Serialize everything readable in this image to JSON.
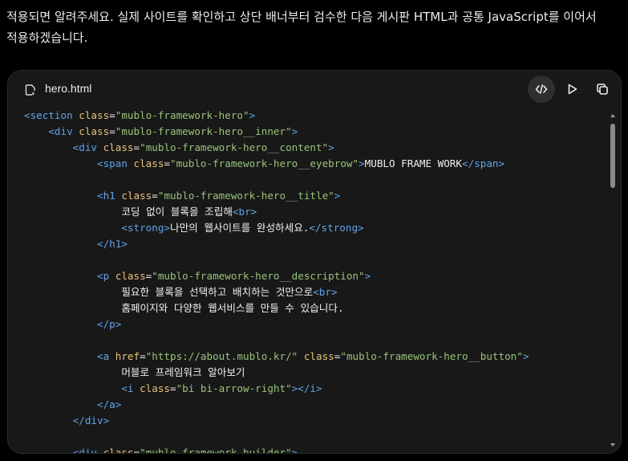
{
  "message": {
    "text": "적용되면 알려주세요. 실제 사이트를 확인하고 상단 배너부터 검수한 다음 게시판 HTML과 공통 JavaScript를 이어서 적용하겠습니다."
  },
  "code_card": {
    "filename": "hero.html",
    "file_icon": "file-code-icon",
    "buttons": {
      "code_toggle_icon": "code-brackets-icon",
      "run_icon": "play-icon",
      "copy_icon": "copy-icon"
    },
    "lines": [
      [
        {
          "t": "tag",
          "v": "<section "
        },
        {
          "t": "attr",
          "v": "class"
        },
        {
          "t": "txt",
          "v": "="
        },
        {
          "t": "val",
          "v": "\"mublo-framework-hero\""
        },
        {
          "t": "tag",
          "v": ">"
        }
      ],
      [
        {
          "t": "txt",
          "v": "    "
        },
        {
          "t": "tag",
          "v": "<div "
        },
        {
          "t": "attr",
          "v": "class"
        },
        {
          "t": "txt",
          "v": "="
        },
        {
          "t": "val",
          "v": "\"mublo-framework-hero__inner\""
        },
        {
          "t": "tag",
          "v": ">"
        }
      ],
      [
        {
          "t": "txt",
          "v": "        "
        },
        {
          "t": "tag",
          "v": "<div "
        },
        {
          "t": "attr",
          "v": "class"
        },
        {
          "t": "txt",
          "v": "="
        },
        {
          "t": "val",
          "v": "\"mublo-framework-hero__content\""
        },
        {
          "t": "tag",
          "v": ">"
        }
      ],
      [
        {
          "t": "txt",
          "v": "            "
        },
        {
          "t": "tag",
          "v": "<span "
        },
        {
          "t": "attr",
          "v": "class"
        },
        {
          "t": "txt",
          "v": "="
        },
        {
          "t": "val",
          "v": "\"mublo-framework-hero__eyebrow\""
        },
        {
          "t": "tag",
          "v": ">"
        },
        {
          "t": "txt",
          "v": "MUBLO FRAME WORK"
        },
        {
          "t": "tag",
          "v": "</span>"
        }
      ],
      [
        {
          "t": "txt",
          "v": ""
        }
      ],
      [
        {
          "t": "txt",
          "v": "            "
        },
        {
          "t": "tag",
          "v": "<h1 "
        },
        {
          "t": "attr",
          "v": "class"
        },
        {
          "t": "txt",
          "v": "="
        },
        {
          "t": "val",
          "v": "\"mublo-framework-hero__title\""
        },
        {
          "t": "tag",
          "v": ">"
        }
      ],
      [
        {
          "t": "txt",
          "v": "                코딩 없이 블록을 조립해"
        },
        {
          "t": "tag",
          "v": "<br>"
        }
      ],
      [
        {
          "t": "txt",
          "v": "                "
        },
        {
          "t": "tag",
          "v": "<strong>"
        },
        {
          "t": "txt",
          "v": "나만의 웹사이트를 완성하세요."
        },
        {
          "t": "tag",
          "v": "</strong>"
        }
      ],
      [
        {
          "t": "txt",
          "v": "            "
        },
        {
          "t": "tag",
          "v": "</h1>"
        }
      ],
      [
        {
          "t": "txt",
          "v": ""
        }
      ],
      [
        {
          "t": "txt",
          "v": "            "
        },
        {
          "t": "tag",
          "v": "<p "
        },
        {
          "t": "attr",
          "v": "class"
        },
        {
          "t": "txt",
          "v": "="
        },
        {
          "t": "val",
          "v": "\"mublo-framework-hero__description\""
        },
        {
          "t": "tag",
          "v": ">"
        }
      ],
      [
        {
          "t": "txt",
          "v": "                필요한 블록을 선택하고 배치하는 것만으로"
        },
        {
          "t": "tag",
          "v": "<br>"
        }
      ],
      [
        {
          "t": "txt",
          "v": "                홈페이지와 다양한 웹서비스를 만들 수 있습니다."
        }
      ],
      [
        {
          "t": "txt",
          "v": "            "
        },
        {
          "t": "tag",
          "v": "</p>"
        }
      ],
      [
        {
          "t": "txt",
          "v": ""
        }
      ],
      [
        {
          "t": "txt",
          "v": "            "
        },
        {
          "t": "tag",
          "v": "<a "
        },
        {
          "t": "attr",
          "v": "href"
        },
        {
          "t": "txt",
          "v": "="
        },
        {
          "t": "val",
          "v": "\"https://about.mublo.kr/\""
        },
        {
          "t": "txt",
          "v": " "
        },
        {
          "t": "attr",
          "v": "class"
        },
        {
          "t": "txt",
          "v": "="
        },
        {
          "t": "val",
          "v": "\"mublo-framework-hero__button\""
        },
        {
          "t": "tag",
          "v": ">"
        }
      ],
      [
        {
          "t": "txt",
          "v": "                머블로 프레임워크 알아보기"
        }
      ],
      [
        {
          "t": "txt",
          "v": "                "
        },
        {
          "t": "tag",
          "v": "<i "
        },
        {
          "t": "attr",
          "v": "class"
        },
        {
          "t": "txt",
          "v": "="
        },
        {
          "t": "val",
          "v": "\"bi bi-arrow-right\""
        },
        {
          "t": "tag",
          "v": "></i>"
        }
      ],
      [
        {
          "t": "txt",
          "v": "            "
        },
        {
          "t": "tag",
          "v": "</a>"
        }
      ],
      [
        {
          "t": "txt",
          "v": "        "
        },
        {
          "t": "tag",
          "v": "</div>"
        }
      ],
      [
        {
          "t": "txt",
          "v": ""
        }
      ],
      [
        {
          "t": "txt",
          "v": "        "
        },
        {
          "t": "tag",
          "v": "<div "
        },
        {
          "t": "attr",
          "v": "class"
        },
        {
          "t": "txt",
          "v": "="
        },
        {
          "t": "val",
          "v": "\"mublo-framework-builder\""
        },
        {
          "t": "tag",
          "v": ">"
        }
      ]
    ]
  },
  "colors": {
    "background": "#000000",
    "card_background": "#181818",
    "tag": "#5fa4e8",
    "attribute": "#e8c27a",
    "string": "#98c379",
    "text": "#f0f0f0"
  }
}
